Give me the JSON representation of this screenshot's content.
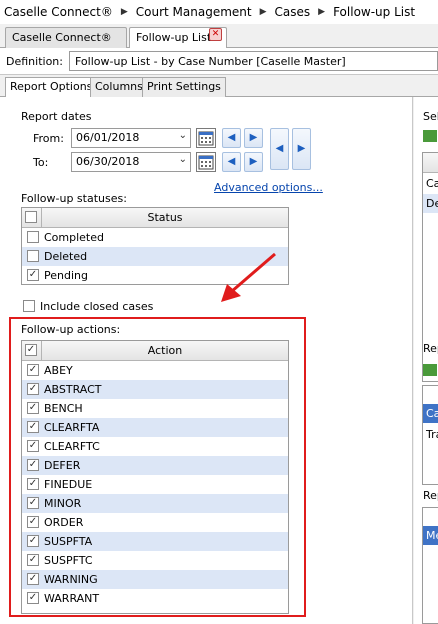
{
  "breadcrumb": [
    "Caselle Connect®",
    "Court Management",
    "Cases",
    "Follow-up List"
  ],
  "tabs": {
    "home": "Caselle Connect®",
    "current": "Follow-up List"
  },
  "definition": {
    "label": "Definition:",
    "value": "Follow-up List - by Case Number [Caselle Master]"
  },
  "option_tabs": [
    "Report Options",
    "Columns",
    "Print Settings"
  ],
  "report_dates": {
    "title": "Report dates",
    "from_label": "From:",
    "from_value": "06/01/2018",
    "to_label": "To:",
    "to_value": "06/30/2018"
  },
  "advanced_link": "Advanced options...",
  "statuses": {
    "title": "Follow-up statuses:",
    "header": "Status",
    "rows": [
      {
        "label": "Completed",
        "checked": false
      },
      {
        "label": "Deleted",
        "checked": false
      },
      {
        "label": "Pending",
        "checked": true
      }
    ]
  },
  "include_closed": {
    "label": "Include closed cases",
    "checked": false
  },
  "actions": {
    "title": "Follow-up actions:",
    "header": "Action",
    "rows": [
      {
        "label": "ABEY",
        "checked": true
      },
      {
        "label": "ABSTRACT",
        "checked": true
      },
      {
        "label": "BENCH",
        "checked": true
      },
      {
        "label": "CLEARFTA",
        "checked": true
      },
      {
        "label": "CLEARFTC",
        "checked": true
      },
      {
        "label": "DEFER",
        "checked": true
      },
      {
        "label": "FINEDUE",
        "checked": true
      },
      {
        "label": "MINOR",
        "checked": true
      },
      {
        "label": "ORDER",
        "checked": true
      },
      {
        "label": "SUSPFTA",
        "checked": true
      },
      {
        "label": "SUSPFTC",
        "checked": true
      },
      {
        "label": "WARNING",
        "checked": true
      },
      {
        "label": "WARRANT",
        "checked": true
      }
    ]
  },
  "right_panel": {
    "sel_label": "Sel",
    "rep_label_1": "Rep",
    "rep_label_2": "Rep",
    "items_top": [
      "Ca",
      "De"
    ],
    "items_mid": [
      "Ca",
      "Tra"
    ],
    "items_bottom": [
      "Me"
    ]
  },
  "colors": {
    "annotation": "#e01c1c",
    "row_alt": "#dce6f6",
    "link": "#0645ad"
  }
}
